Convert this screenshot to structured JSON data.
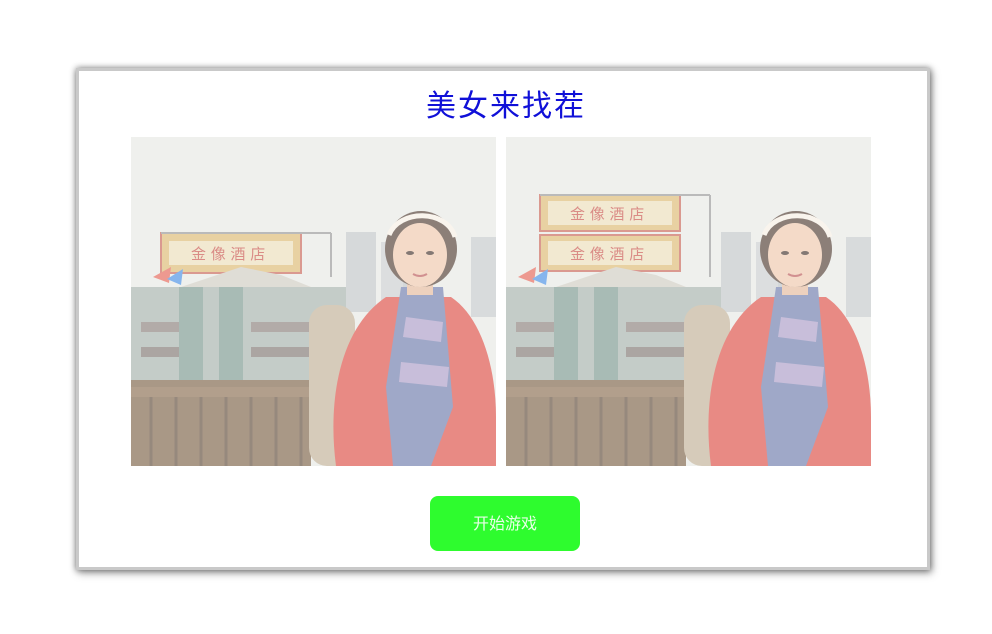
{
  "game": {
    "title": "美女来找茬",
    "start_button_label": "开始游戏"
  },
  "images": [
    {
      "name": "original-photo",
      "subject": "woman-in-red-coat"
    },
    {
      "name": "modified-photo",
      "subject": "woman-in-red-coat"
    }
  ],
  "colors": {
    "title": "#1010d8",
    "start_button": "#2efc2e",
    "panel_border": "#c9c9c9"
  }
}
